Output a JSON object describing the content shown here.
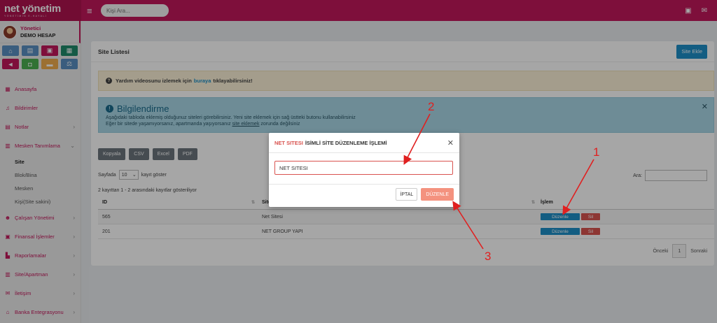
{
  "topbar": {
    "logo_name": "net yönetim",
    "logo_tag": "YÖNETİMİN E-HAYALİ",
    "search_placeholder": "Kişi Ara...",
    "colors": {
      "brand": "#c2185b",
      "primary": "#1e90c8",
      "danger": "#d9534f"
    }
  },
  "user": {
    "role": "Yönetici",
    "account": "DEMO HESAP"
  },
  "quick_buttons": [
    {
      "icon": "home-icon",
      "glyph": "⌂",
      "color": "#5a8fc2"
    },
    {
      "icon": "printer-icon",
      "glyph": "▤",
      "color": "#5a8fc2"
    },
    {
      "icon": "money-icon",
      "glyph": "▣",
      "color": "#c2185b"
    },
    {
      "icon": "address-book-icon",
      "glyph": "▦",
      "color": "#1f8a6b"
    },
    {
      "icon": "megaphone-icon",
      "glyph": "◄",
      "color": "#c2185b"
    },
    {
      "icon": "cash-icon",
      "glyph": "◘",
      "color": "#4caf50"
    },
    {
      "icon": "chat-icon",
      "glyph": "▬",
      "color": "#f0ad4e"
    },
    {
      "icon": "scale-icon",
      "glyph": "⚖",
      "color": "#5a8fc2"
    }
  ],
  "menu": {
    "home": "Anasayfa",
    "notifications": "Bildirimler",
    "notes": "Notlar",
    "definitions": "Mesken Tanımlama",
    "sub_site": "Site",
    "sub_block": "Blok/Bina",
    "sub_mesken": "Mesken",
    "sub_person": "Kişi(Site sakini)",
    "staff": "Çalışan Yönetimi",
    "finance": "Finansal İşlemler",
    "reports": "Raporlamalar",
    "site_apartment": "Site/Apartman",
    "contact": "İletişim",
    "bank": "Banka Entegrasyonu"
  },
  "card": {
    "title": "Site Listesi",
    "add_button": "Site Ekle",
    "help_before": "Yardım videosunu izlemek için",
    "help_link": "buraya",
    "help_after": "tıklayabilirsiniz!",
    "info_title": "Bilgilendirme",
    "info_line1": "Aşağıdaki tabloda eklemiş olduğunuz siteleri görebilirsiniz. Yeni site eklemek için sağ üstteki butonu kullanabilirsiniz",
    "info_line2_before": "Eğer bir sitede yaşamıyorsanız, apartmanda yaşıyorsanız",
    "info_line2_link": "site eklemek",
    "info_line2_after": "zorunda değilsiniz",
    "tools": [
      "Kopyala",
      "CSV",
      "Excel",
      "PDF"
    ],
    "length_prefix": "Sayfada",
    "length_value": "10",
    "length_suffix": "kayıt göster",
    "filter_label": "Ara:",
    "count_text": "2 kayıttan 1 - 2 arasındaki kayıtlar gösteriliyor",
    "columns": [
      "ID",
      "Site",
      "İşlem"
    ],
    "rows": [
      {
        "id": "565",
        "name": "Net Sitesi",
        "edit": "Düzenle",
        "delete": "Sil"
      },
      {
        "id": "201",
        "name": "NET GROUP YAPI",
        "edit": "Düzenle",
        "delete": "Sil"
      }
    ],
    "pager_prev": "Önceki",
    "pager_page": "1",
    "pager_next": "Sonraki"
  },
  "modal": {
    "title_highlight": "NET SITESI",
    "title_rest": "İSİMLİ SİTE DÜZENLEME İŞLEMİ",
    "input_value": "NET SITESI",
    "cancel": "İPTAL",
    "save": "DÜZENLE"
  },
  "annotations": [
    "1",
    "2",
    "3"
  ]
}
